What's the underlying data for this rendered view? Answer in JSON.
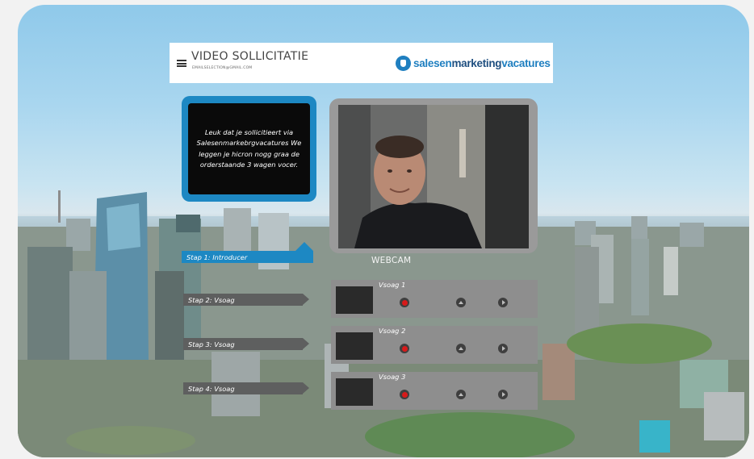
{
  "header": {
    "title": "VIDEO SOLLICITATIE",
    "email": "EMAILSELECTION@GMAIL.COM",
    "logo": {
      "part1": "salesen",
      "part2": "marketing",
      "part3": "vacatures"
    }
  },
  "intro": {
    "text": "Leuk dat je sollicitieert via Salesenmarkebrgvacatures We leggen je hicron nogg graa de orderstaande 3 wagen vocer."
  },
  "webcam": {
    "label": "WEBCAM"
  },
  "steps": [
    {
      "label": "Stap 1: Introducer"
    },
    {
      "label": "Stap 2: Vsoag"
    },
    {
      "label": "Stap 3: Vsoag"
    },
    {
      "label": "Stap 4: Vsoag"
    }
  ],
  "questions": [
    {
      "title": "Vsoag 1"
    },
    {
      "title": "Vsoag 2"
    },
    {
      "title": "Vsoag 3"
    }
  ],
  "colors": {
    "accent": "#1d88c3",
    "record": "#d81a1a",
    "panel": "#8e8e8e",
    "step_gray": "#5e5f5f"
  },
  "icons": {
    "menu": "hamburger-menu-icon",
    "record": "record-icon",
    "upload": "upload-icon",
    "play": "play-icon",
    "logo": "tooth-logo-icon"
  }
}
